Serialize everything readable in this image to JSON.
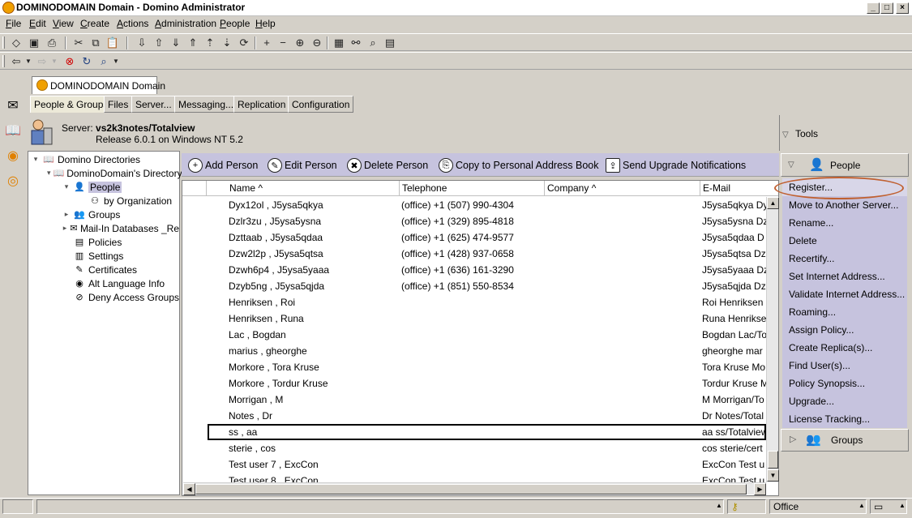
{
  "window": {
    "title": "DOMINODOMAIN Domain - Domino Administrator"
  },
  "menu": [
    {
      "label": "File",
      "ul": "F",
      "rest": "ile"
    },
    {
      "label": "Edit",
      "ul": "E",
      "rest": "dit"
    },
    {
      "label": "View",
      "ul": "V",
      "rest": "iew"
    },
    {
      "label": "Create",
      "ul": "C",
      "rest": "reate"
    },
    {
      "label": "Actions",
      "ul": "A",
      "rest": "ctions"
    },
    {
      "label": "Administration",
      "ul": "A",
      "rest": "dministration"
    },
    {
      "label": "People",
      "ul": "P",
      "rest": "eople"
    },
    {
      "label": "Help",
      "ul": "H",
      "rest": "elp"
    }
  ],
  "domain_tab": {
    "label": "DOMINODOMAIN Domain"
  },
  "sub_tabs": [
    "People & Groups",
    "Files",
    "Server...",
    "Messaging...",
    "Replication",
    "Configuration"
  ],
  "server": {
    "prefix": "Server: ",
    "name": "vs2k3notes/Totalview",
    "release": "Release 6.0.1 on Windows NT 5.2"
  },
  "tools": {
    "label": "Tools"
  },
  "tree": [
    {
      "label": "Domino Directories",
      "indent": 0,
      "toggle": "▾",
      "icon": "book-icon",
      "glyph": "📖"
    },
    {
      "label": "DominoDomain's Directory",
      "indent": 1,
      "toggle": "▾",
      "icon": "book-icon",
      "glyph": "📖"
    },
    {
      "label": "People",
      "indent": 2,
      "toggle": "▾",
      "icon": "person-icon",
      "glyph": "👤",
      "selected": true
    },
    {
      "label": "by Organization",
      "indent": 3,
      "toggle": "",
      "icon": "org-icon",
      "glyph": "⚇"
    },
    {
      "label": "Groups",
      "indent": 2,
      "toggle": "▸",
      "icon": "groups-icon",
      "glyph": "👥"
    },
    {
      "label": "Mail-In Databases _Re",
      "indent": 2,
      "toggle": "▸",
      "icon": "mailin-icon",
      "glyph": "✉"
    },
    {
      "label": "Policies",
      "indent": 2,
      "toggle": "",
      "icon": "policies-icon",
      "glyph": "▤"
    },
    {
      "label": "Settings",
      "indent": 2,
      "toggle": "",
      "icon": "settings-icon",
      "glyph": "▥"
    },
    {
      "label": "Certificates",
      "indent": 2,
      "toggle": "",
      "icon": "certificates-icon",
      "glyph": "✎"
    },
    {
      "label": "Alt Language Info",
      "indent": 2,
      "toggle": "",
      "icon": "globe-icon",
      "glyph": "◉"
    },
    {
      "label": "Deny Access Groups",
      "indent": 2,
      "toggle": "",
      "icon": "deny-icon",
      "glyph": "⊘"
    }
  ],
  "actions": [
    {
      "label": "Add Person",
      "glyph": "+"
    },
    {
      "label": "Edit Person",
      "glyph": "✎"
    },
    {
      "label": "Delete Person",
      "glyph": "✖"
    },
    {
      "label": "Copy to Personal Address Book",
      "glyph": "⎘"
    },
    {
      "label": "Send Upgrade Notifications",
      "glyph": "⇪"
    }
  ],
  "columns": {
    "name": "Name ^",
    "telephone": "Telephone",
    "company": "Company ^",
    "email": "E-Mail"
  },
  "rows": [
    {
      "name": "Dyx12ol , J5ysa5qkya",
      "tel": "(office)  +1 (507) 990-4304",
      "mail": "J5ysa5qkya Dy"
    },
    {
      "name": "Dzlr3zu , J5ysa5ysna",
      "tel": "(office)  +1 (329) 895-4818",
      "mail": "J5ysa5ysna Dz"
    },
    {
      "name": "Dzttaab , J5ysa5qdaa",
      "tel": "(office)  +1 (625) 474-9577",
      "mail": "J5ysa5qdaa D"
    },
    {
      "name": "Dzw2l2p , J5ysa5qtsa",
      "tel": "(office)  +1 (428) 937-0658",
      "mail": "J5ysa5qtsa Dz"
    },
    {
      "name": "Dzwh6p4 , J5ysa5yaaa",
      "tel": "(office)  +1 (636) 161-3290",
      "mail": "J5ysa5yaaa Dz"
    },
    {
      "name": "Dzyb5ng , J5ysa5qjda",
      "tel": "(office)  +1 (851) 550-8534",
      "mail": "J5ysa5qjda Dz"
    },
    {
      "name": "Henriksen , Roi",
      "tel": "",
      "mail": "Roi Henriksen"
    },
    {
      "name": "Henriksen , Runa",
      "tel": "",
      "mail": "Runa Henrikse"
    },
    {
      "name": "Lac , Bogdan",
      "tel": "",
      "mail": "Bogdan Lac/To"
    },
    {
      "name": "marius , gheorghe",
      "tel": "",
      "mail": "gheorghe mar"
    },
    {
      "name": "Morkore , Tora Kruse",
      "tel": "",
      "mail": "Tora Kruse Mo"
    },
    {
      "name": "Morkore , Tordur Kruse",
      "tel": "",
      "mail": "Tordur Kruse M"
    },
    {
      "name": "Morrigan , M",
      "tel": "",
      "mail": "M Morrigan/To"
    },
    {
      "name": "Notes , Dr",
      "tel": "",
      "mail": "Dr Notes/Total"
    },
    {
      "name": "ss , aa",
      "tel": "",
      "mail": "aa ss/Totalview",
      "selected": true
    },
    {
      "name": "sterie , cos",
      "tel": "",
      "mail": "cos sterie/cert"
    },
    {
      "name": "Test user 7 , ExcCon",
      "tel": "",
      "mail": "ExcCon Test u"
    },
    {
      "name": "Test user 8 , ExcCon",
      "tel": "",
      "mail": "ExcCon Test u"
    }
  ],
  "tool_panel": {
    "people_header": "People",
    "groups_header": "Groups",
    "items": [
      "Register...",
      "Move to Another Server...",
      "Rename...",
      "Delete",
      "Recertify...",
      "Set Internet Address...",
      "Validate Internet Address...",
      "Roaming...",
      "Assign Policy...",
      "Create Replica(s)...",
      "Find User(s)...",
      "Policy Synopsis...",
      "Upgrade...",
      "License Tracking..."
    ]
  },
  "status": {
    "location": "Office"
  },
  "colors": {
    "action_bar": "#c6c3de",
    "tools_list": "#c6c3de",
    "highlight_circle": "#c06030",
    "chrome": "#d4d0c8"
  }
}
